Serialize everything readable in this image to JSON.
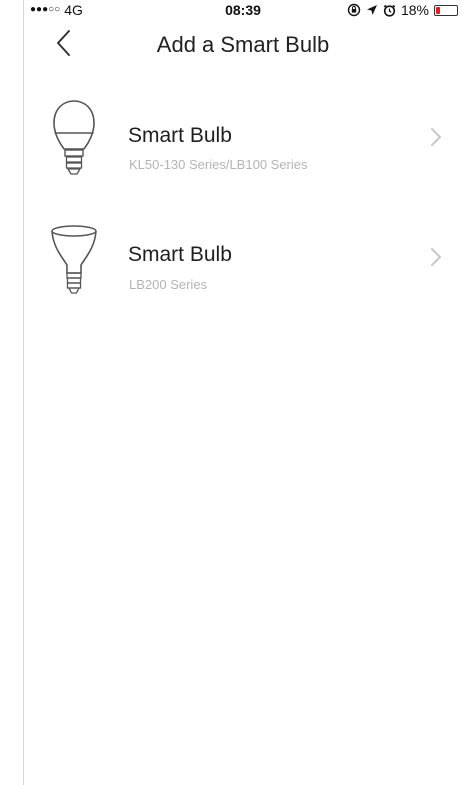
{
  "status_bar": {
    "signal": "●●●○○",
    "carrier": "4G",
    "time": "08:39",
    "battery_percent": "18%",
    "battery_level": 0.18,
    "battery_color": "#e02020"
  },
  "nav": {
    "title": "Add a Smart Bulb"
  },
  "devices": [
    {
      "name": "Smart Bulb",
      "series": "KL50-130 Series/LB100 Series",
      "icon": "a19-bulb-icon"
    },
    {
      "name": "Smart Bulb",
      "series": "LB200 Series",
      "icon": "br30-flood-bulb-icon"
    }
  ],
  "colors": {
    "subtitle": "#b4b4b4",
    "chevron": "#c7c7cc",
    "icon_stroke": "#555555"
  }
}
